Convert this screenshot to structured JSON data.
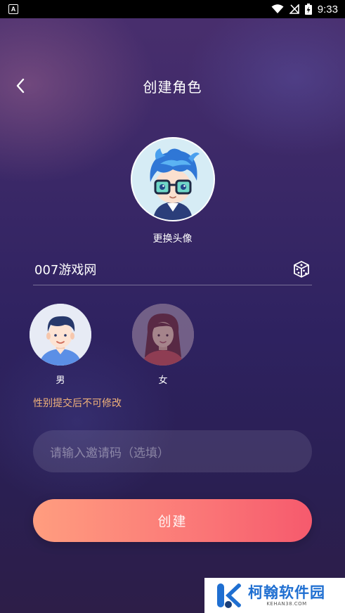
{
  "status_bar": {
    "app_icon_letter": "A",
    "time": "9:33"
  },
  "header": {
    "title": "创建角色"
  },
  "avatar": {
    "change_label": "更换头像"
  },
  "name": {
    "value": "007游戏网"
  },
  "gender": {
    "male_label": "男",
    "female_label": "女",
    "note": "性别提交后不可修改"
  },
  "invite": {
    "placeholder": "请输入邀请码（选填）"
  },
  "create_button": {
    "label": "创建"
  },
  "watermark": {
    "text_cn": "柯翰软件园",
    "text_en": "KEHAN38.COM"
  },
  "colors": {
    "accent_start": "#ff9d7f",
    "accent_end": "#f65a6d",
    "note_color": "#f0b27a"
  }
}
